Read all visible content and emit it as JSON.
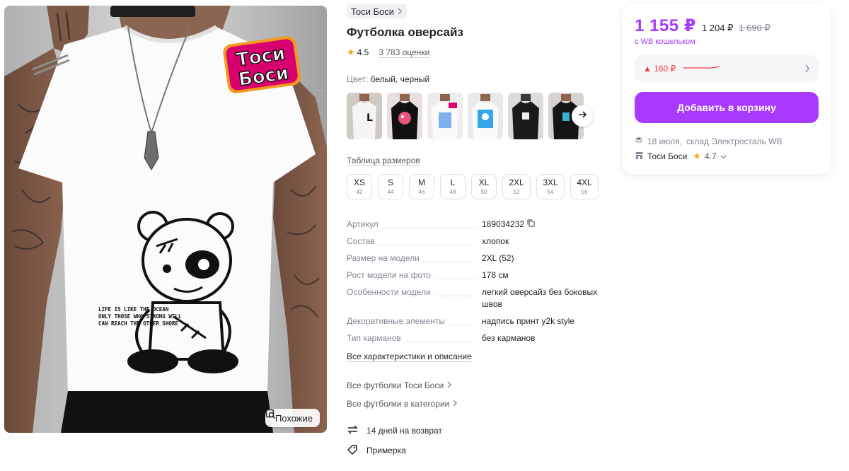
{
  "product_image": {
    "logo_text_line1": "Тоси",
    "logo_text_line2": "Боси",
    "print_text": [
      "LIFE IS LIKE THE OCEAN",
      "ONLY THOSE WHO STRONG WILL",
      "CAN REACH THE OTHER SHORE"
    ],
    "similar_label": "Похожие"
  },
  "brand": {
    "name": "Тоси Боси"
  },
  "title": "Футболка оверсайз",
  "rating": {
    "value": "4.5",
    "reviews": "3 783 оценки"
  },
  "color": {
    "label": "Цвет:",
    "value": "белый, черный"
  },
  "thumbnails": [
    {
      "name": "thumb-white-l"
    },
    {
      "name": "thumb-black-bear"
    },
    {
      "name": "thumb-white-tosi"
    },
    {
      "name": "thumb-white-blue-print"
    },
    {
      "name": "thumb-black-back"
    },
    {
      "name": "thumb-black-face"
    }
  ],
  "size_table_label": "Таблица размеров",
  "sizes": [
    {
      "label": "XS",
      "ru": "42"
    },
    {
      "label": "S",
      "ru": "44"
    },
    {
      "label": "M",
      "ru": "46"
    },
    {
      "label": "L",
      "ru": "48"
    },
    {
      "label": "XL",
      "ru": "50"
    },
    {
      "label": "2XL",
      "ru": "52"
    },
    {
      "label": "3XL",
      "ru": "54"
    },
    {
      "label": "4XL",
      "ru": "56"
    }
  ],
  "specs": [
    {
      "key": "Артикул",
      "value": "189034232"
    },
    {
      "key": "Состав",
      "value": "хлопок"
    },
    {
      "key": "Размер на модели",
      "value": "2XL (52)"
    },
    {
      "key": "Рост модели на фото",
      "value": "178 см"
    },
    {
      "key": "Особенности модели",
      "value": "легкий оверсайз без боковых швов"
    },
    {
      "key": "Декоративные элементы",
      "value": "надпись принт y2k style"
    },
    {
      "key": "Тип карманов",
      "value": "без карманов"
    }
  ],
  "all_characteristics": "Все характеристики и описание",
  "category_links": {
    "brand_tshirts": "Все футболки Тоси Боси",
    "category_tshirts": "Все футболки в категории"
  },
  "features": {
    "return": "14 дней на возврат",
    "try_on": "Примерка"
  },
  "buy_card": {
    "price": "1 155 ₽",
    "price_without_wallet": "1 204 ₽",
    "price_old": "1 690 ₽",
    "wallet_note": "с WB кошельком",
    "price_change": "▲ 160 ₽",
    "add_to_cart": "Добавить в корзину",
    "delivery_date": "18 июля,",
    "delivery_warehouse": "склад Электросталь WB",
    "seller_name": "Тоси Боси",
    "seller_rating": "4.7"
  },
  "colors": {
    "accent": "#a73afd",
    "price_up": "#f53c3c",
    "star": "#f5a623"
  }
}
